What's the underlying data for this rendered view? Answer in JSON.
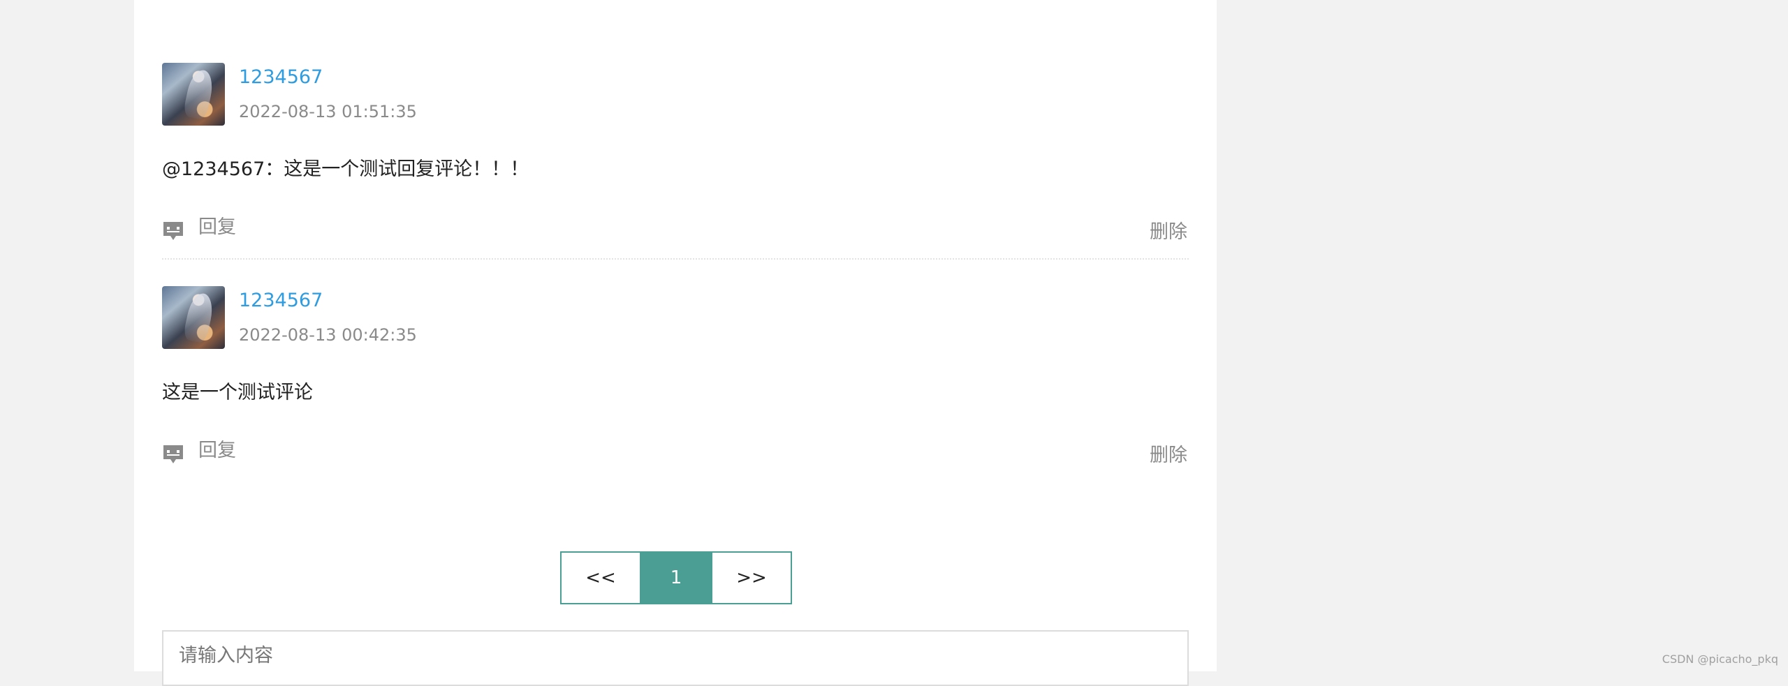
{
  "comments": [
    {
      "username": "1234567",
      "time": "2022-08-13 01:51:35",
      "content": "@1234567：这是一个测试回复评论！！！",
      "reply_label": "回复",
      "delete_label": "删除"
    },
    {
      "username": "1234567",
      "time": "2022-08-13 00:42:35",
      "content": "这是一个测试评论",
      "reply_label": "回复",
      "delete_label": "删除"
    }
  ],
  "pagination": {
    "prev": "<<",
    "current": "1",
    "next": ">>"
  },
  "input": {
    "placeholder": "请输入内容"
  },
  "watermark": "CSDN @picacho_pkq",
  "colors": {
    "accent": "#4a9e93",
    "username": "#2f9ce0",
    "page_bg": "#f2f2f2"
  }
}
